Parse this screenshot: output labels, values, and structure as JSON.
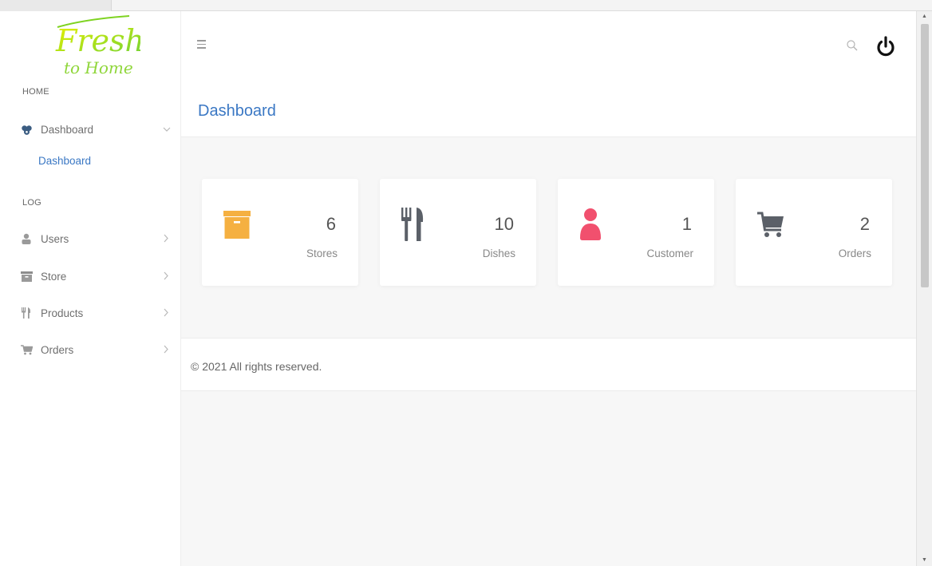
{
  "brand": {
    "logo_text_1": "Fresh",
    "logo_text_2": "to Home"
  },
  "sidebar": {
    "sections": [
      {
        "label": "HOME"
      },
      {
        "label": "LOG"
      }
    ],
    "items": [
      {
        "label": "Dashboard",
        "icon": "dashboard-icon",
        "chevron": "chevron-down-icon",
        "sub": [
          {
            "label": "Dashboard"
          }
        ]
      },
      {
        "label": "Users",
        "icon": "user-icon",
        "chevron": "chevron-right-icon"
      },
      {
        "label": "Store",
        "icon": "archive-icon",
        "chevron": "chevron-right-icon"
      },
      {
        "label": "Products",
        "icon": "cutlery-icon",
        "chevron": "chevron-right-icon"
      },
      {
        "label": "Orders",
        "icon": "cart-icon",
        "chevron": "chevron-right-icon"
      }
    ]
  },
  "topbar": {
    "menu_icon": "hamburger-icon",
    "search_icon": "search-icon",
    "power_icon": "power-icon"
  },
  "page": {
    "title": "Dashboard"
  },
  "cards": [
    {
      "value": "6",
      "label": "Stores",
      "icon": "archive-icon",
      "color": "#f5b041"
    },
    {
      "value": "10",
      "label": "Dishes",
      "icon": "cutlery-icon",
      "color": "#5b6068"
    },
    {
      "value": "1",
      "label": "Customer",
      "icon": "user-icon",
      "color": "#f1506e"
    },
    {
      "value": "2",
      "label": "Orders",
      "icon": "cart-icon",
      "color": "#5b6068"
    }
  ],
  "footer": {
    "text": "© 2021 All rights reserved."
  },
  "colors": {
    "accent": "#3b78c4",
    "logo_green": "#7ed321",
    "logo_yellow": "#e8f000"
  }
}
